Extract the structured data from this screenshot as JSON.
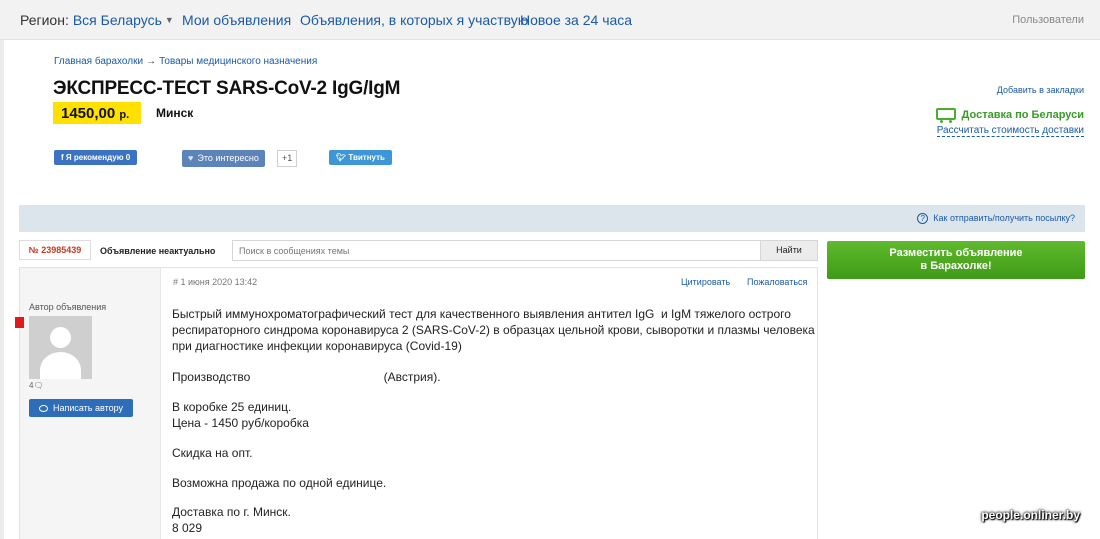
{
  "topbar": {
    "region_label": "Регион:",
    "region_value": "Вся Беларусь",
    "nav": [
      "Мои объявления",
      "Объявления, в которых я участвую",
      "Новое за 24 часа"
    ],
    "users": "Пользователи"
  },
  "breadcrumb": {
    "home": "Главная барахолки",
    "arrow": "→",
    "category": "Товары медицинского назначения"
  },
  "listing": {
    "title": "ЭКСПРЕСС-ТЕСТ SARS-CoV-2 IgG/IgM",
    "price_value": "1450,00",
    "price_currency": "р.",
    "city": "Минск"
  },
  "aside": {
    "bookmark": "Добавить в закладки",
    "delivery": "Доставка по Беларуси",
    "calc": "Рассчитать стоимость доставки"
  },
  "social": {
    "fb": "f Я рекомендую 0",
    "interest": "Это интересно",
    "plus": "+1",
    "tweet": "Твитнуть"
  },
  "infobar": {
    "help": "Как отправить/получить посылку?",
    "help_icon": "?"
  },
  "controls": {
    "ad_number": "№ 23985439",
    "status": "Объявление неактуально",
    "search_placeholder": "Поиск в сообщениях темы",
    "search_button": "Найти",
    "post_ad_line1": "Разместить объявление",
    "post_ad_line2": "в Барахолке!"
  },
  "post": {
    "author_label": "Автор объявления",
    "msg_count": "4",
    "write_author": "Написать автору",
    "date": "# 1 июня 2020 13:42",
    "quote": "Цитировать",
    "complain": "Пожаловаться",
    "lines": [
      "Быстрый иммунохроматографический тест для качественного выявления антител IgG  и IgM тяжелого острого",
      "респираторного синдрома коронавируса 2 (SARS-CoV-2) в образцах цельной крови, сыворотки и плазмы человека",
      "при диагностике инфекции коронавируса (Covid-19)",
      "Производство                                        (Австрия).",
      "В коробке 25 единиц.",
      "Цена - 1450 руб/коробка",
      "Скидка на опт.",
      "Возможна продажа по одной единице.",
      "Доставка по г. Минск.",
      "8 029"
    ]
  },
  "watermark": "people.onliner.by",
  "colors": {
    "link": "#1a5aa6",
    "price_bg": "#ffe000",
    "post_btn": "#4aa81f",
    "ad_num": "#c23b22"
  }
}
